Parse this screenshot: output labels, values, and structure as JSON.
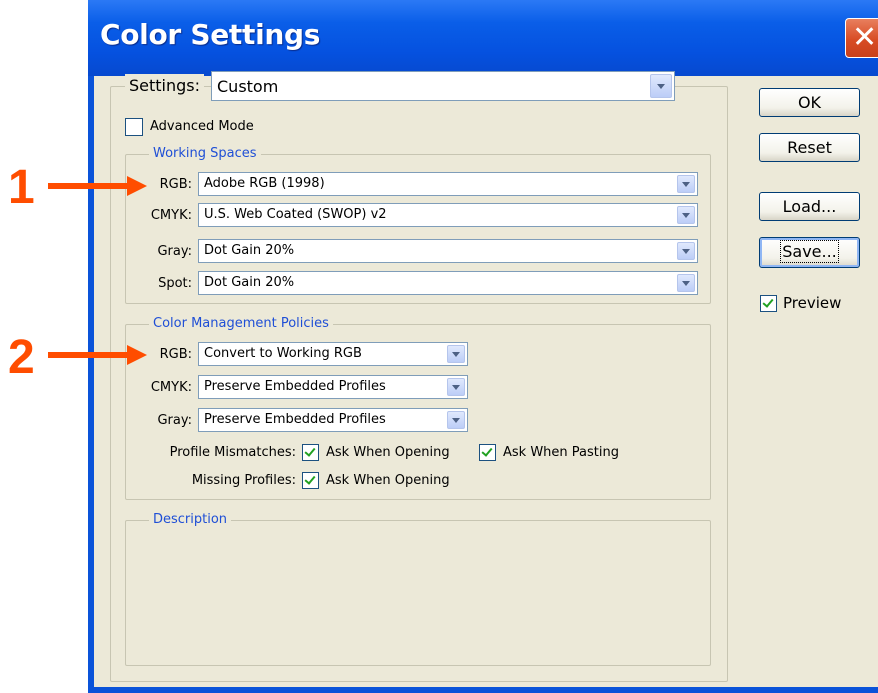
{
  "window": {
    "title": "Color Settings",
    "close_glyph": "✕"
  },
  "settings": {
    "label": "Settings:",
    "value": "Custom"
  },
  "advanced_mode": {
    "label": "Advanced Mode",
    "checked": false
  },
  "working_spaces": {
    "legend": "Working Spaces",
    "rows": [
      {
        "label": "RGB:",
        "value": "Adobe RGB (1998)"
      },
      {
        "label": "CMYK:",
        "value": "U.S. Web Coated (SWOP) v2"
      },
      {
        "label": "Gray:",
        "value": "Dot Gain 20%"
      },
      {
        "label": "Spot:",
        "value": "Dot Gain 20%"
      }
    ]
  },
  "policies": {
    "legend": "Color Management Policies",
    "rows": [
      {
        "label": "RGB:",
        "value": "Convert to Working RGB"
      },
      {
        "label": "CMYK:",
        "value": "Preserve Embedded Profiles"
      },
      {
        "label": "Gray:",
        "value": "Preserve Embedded Profiles"
      }
    ],
    "profile_mismatches": {
      "label": "Profile Mismatches:",
      "ask_opening": "Ask When Opening",
      "ask_pasting": "Ask When Pasting"
    },
    "missing_profiles": {
      "label": "Missing Profiles:",
      "ask_opening": "Ask When Opening"
    }
  },
  "description": {
    "legend": "Description"
  },
  "buttons": {
    "ok": "OK",
    "reset": "Reset",
    "load": "Load...",
    "save": "Save..."
  },
  "preview": {
    "label": "Preview",
    "checked": true
  },
  "annotations": {
    "one": "1",
    "two": "2"
  },
  "colors": {
    "title_bar": "#0551df",
    "client": "#ece9d8",
    "annotation": "#ff4d00",
    "legend_text": "#1f4fd6"
  }
}
